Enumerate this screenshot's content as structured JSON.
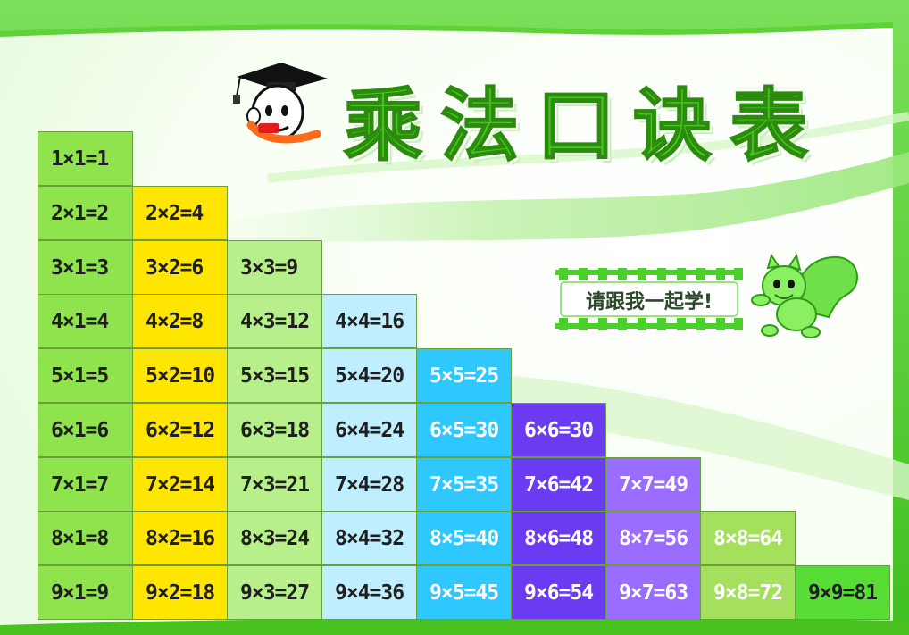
{
  "title": "乘法口诀表",
  "banner_text": "请跟我一起学!",
  "icons": [
    "graduate-boy-mascot-icon",
    "squirrel-mascot-icon"
  ],
  "colors": {
    "border_green": "#7be05a",
    "title_green": "#47c21e",
    "columns": [
      "#8fe34c",
      "#ffe600",
      "#b7f08a",
      "#bfefff",
      "#2ec8ff",
      "#6a3bf0",
      "#9a6cff",
      "#a4e05c",
      "#57dd36"
    ]
  },
  "table": {
    "columns": [
      {
        "color": "#8fe34c",
        "text_color": "#1f1f1f",
        "items": [
          "1×1=1",
          "2×1=2",
          "3×1=3",
          "4×1=4",
          "5×1=5",
          "6×1=6",
          "7×1=7",
          "8×1=8",
          "9×1=9"
        ]
      },
      {
        "color": "#ffe600",
        "text_color": "#1f1f1f",
        "items": [
          "2×2=4",
          "3×2=6",
          "4×2=8",
          "5×2=10",
          "6×2=12",
          "7×2=14",
          "8×2=16",
          "9×2=18"
        ]
      },
      {
        "color": "#b7f08a",
        "text_color": "#1f1f1f",
        "items": [
          "3×3=9",
          "4×3=12",
          "5×3=15",
          "6×3=18",
          "7×3=21",
          "8×3=24",
          "9×3=27"
        ]
      },
      {
        "color": "#bfefff",
        "text_color": "#1f1f1f",
        "items": [
          "4×4=16",
          "5×4=20",
          "6×4=24",
          "7×4=28",
          "8×4=32",
          "9×4=36"
        ]
      },
      {
        "color": "#2ec8ff",
        "text_color": "#ffffff",
        "items": [
          "5×5=25",
          "6×5=30",
          "7×5=35",
          "8×5=40",
          "9×5=45"
        ]
      },
      {
        "color": "#6a3bf0",
        "text_color": "#ffffff",
        "items": [
          "6×6=30",
          "7×6=42",
          "8×6=48",
          "9×6=54"
        ]
      },
      {
        "color": "#9a6cff",
        "text_color": "#ffffff",
        "items": [
          "7×7=49",
          "8×7=56",
          "9×7=63"
        ]
      },
      {
        "color": "#a4e05c",
        "text_color": "#ffffff",
        "items": [
          "8×8=64",
          "9×8=72"
        ]
      },
      {
        "color": "#57dd36",
        "text_color": "#1f1f1f",
        "items": [
          "9×9=81"
        ]
      }
    ]
  }
}
